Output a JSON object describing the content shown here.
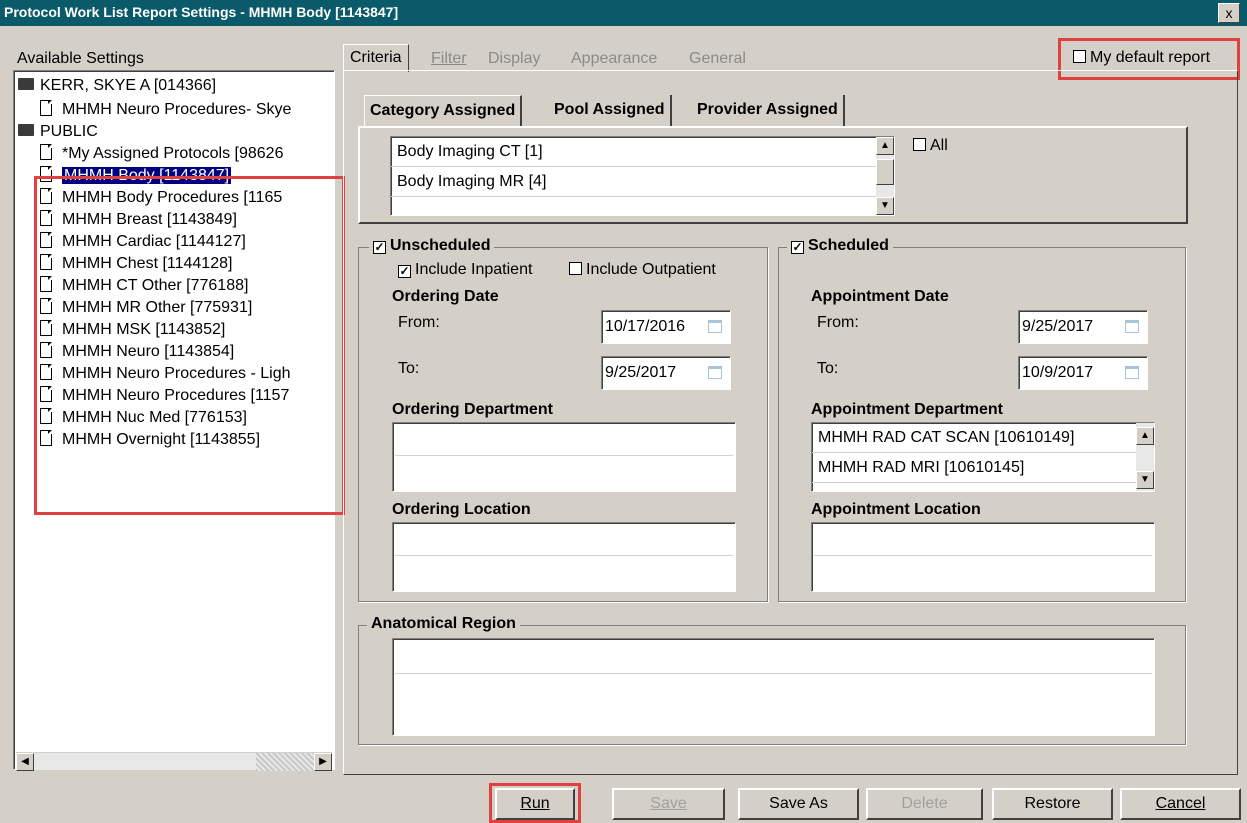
{
  "window": {
    "title": "Protocol Work List Report Settings - MHMH Body [1143847]",
    "close_label": "x"
  },
  "sidebar": {
    "header": "Available Settings",
    "items": [
      {
        "label": "KERR, SKYE A [014366]",
        "icon": "user-folder-icon"
      },
      {
        "label": "MHMH Neuro Procedures- Skye",
        "icon": "locked-document-icon"
      },
      {
        "label": "PUBLIC",
        "icon": "folder-icon"
      },
      {
        "label": "*My Assigned Protocols [98626",
        "icon": "document-icon"
      },
      {
        "label": "MHMH Body [1143847]",
        "icon": "document-icon",
        "selected": true
      },
      {
        "label": "MHMH Body Procedures [1165",
        "icon": "document-icon"
      },
      {
        "label": "MHMH Breast [1143849]",
        "icon": "document-icon"
      },
      {
        "label": "MHMH Cardiac [1144127]",
        "icon": "document-icon"
      },
      {
        "label": "MHMH Chest [1144128]",
        "icon": "document-icon"
      },
      {
        "label": "MHMH CT Other [776188]",
        "icon": "document-icon"
      },
      {
        "label": "MHMH MR Other [775931]",
        "icon": "document-icon"
      },
      {
        "label": "MHMH MSK [1143852]",
        "icon": "document-icon"
      },
      {
        "label": "MHMH Neuro [1143854]",
        "icon": "document-icon"
      },
      {
        "label": "MHMH Neuro Procedures - Ligh",
        "icon": "document-icon"
      },
      {
        "label": "MHMH Neuro Procedures [1157",
        "icon": "document-icon"
      },
      {
        "label": "MHMH Nuc Med [776153]",
        "icon": "document-icon"
      },
      {
        "label": "MHMH Overnight [1143855]",
        "icon": "document-icon"
      }
    ]
  },
  "tabs": [
    "Criteria",
    "Filter",
    "Display",
    "Appearance",
    "General"
  ],
  "active_tab": "Criteria",
  "default_report": {
    "label": "My default report",
    "checked": false
  },
  "assignment_tabs": [
    "Category Assigned",
    "Pool Assigned",
    "Provider Assigned"
  ],
  "category_list": [
    "Body Imaging CT [1]",
    "Body Imaging MR [4]"
  ],
  "all_checkbox": {
    "label": "All",
    "checked": false
  },
  "unscheduled": {
    "title": "Unscheduled",
    "checked": true,
    "include_inpatient": {
      "label": "Include Inpatient",
      "checked": true
    },
    "include_outpatient": {
      "label": "Include Outpatient",
      "checked": false
    },
    "date_label": "Ordering Date",
    "from_label": "From:",
    "from_value": "10/17/2016",
    "to_label": "To:",
    "to_value": "9/25/2017",
    "department_label": "Ordering Department",
    "location_label": "Ordering Location"
  },
  "scheduled": {
    "title": "Scheduled",
    "checked": true,
    "date_label": "Appointment Date",
    "from_label": "From:",
    "from_value": "9/25/2017",
    "to_label": "To:",
    "to_value": "10/9/2017",
    "department_label": "Appointment Department",
    "departments": [
      "MHMH RAD CAT SCAN [10610149]",
      "MHMH RAD MRI [10610145]"
    ],
    "location_label": "Appointment Location"
  },
  "anatomical_region": {
    "title": "Anatomical Region"
  },
  "buttons": {
    "run": "Run",
    "save": "Save",
    "save_as": "Save As",
    "delete": "Delete",
    "restore": "Restore",
    "cancel": "Cancel"
  },
  "colors": {
    "titlebar": "#0a5a6a",
    "selection": "#000080",
    "highlight_box": "#e04040",
    "window_face": "#d4d0c8"
  }
}
